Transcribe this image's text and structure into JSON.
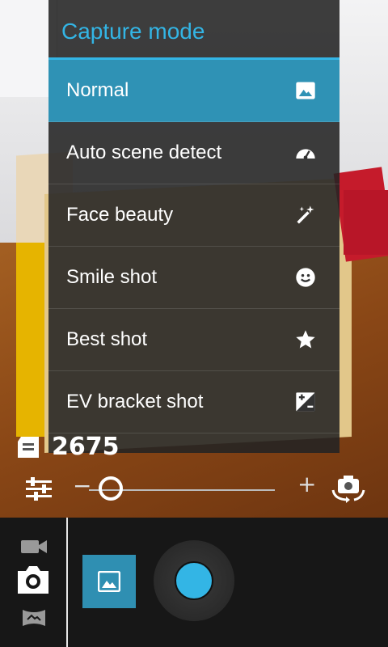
{
  "menu": {
    "title": "Capture mode",
    "items": [
      {
        "label": "Normal",
        "icon": "image-icon",
        "selected": true
      },
      {
        "label": "Auto scene detect",
        "icon": "speedometer-icon",
        "selected": false
      },
      {
        "label": "Face beauty",
        "icon": "magic-wand-icon",
        "selected": false
      },
      {
        "label": "Smile shot",
        "icon": "smile-icon",
        "selected": false
      },
      {
        "label": "Best shot",
        "icon": "star-icon",
        "selected": false
      },
      {
        "label": "EV bracket shot",
        "icon": "exposure-icon",
        "selected": false
      }
    ]
  },
  "storage": {
    "icon": "sd-card-icon",
    "remaining": "2675"
  },
  "zoom": {
    "minus": "−",
    "plus": "+",
    "level": 0.0
  },
  "colors": {
    "accent": "#33b5e5",
    "selected_bg": "#2f92b5"
  }
}
